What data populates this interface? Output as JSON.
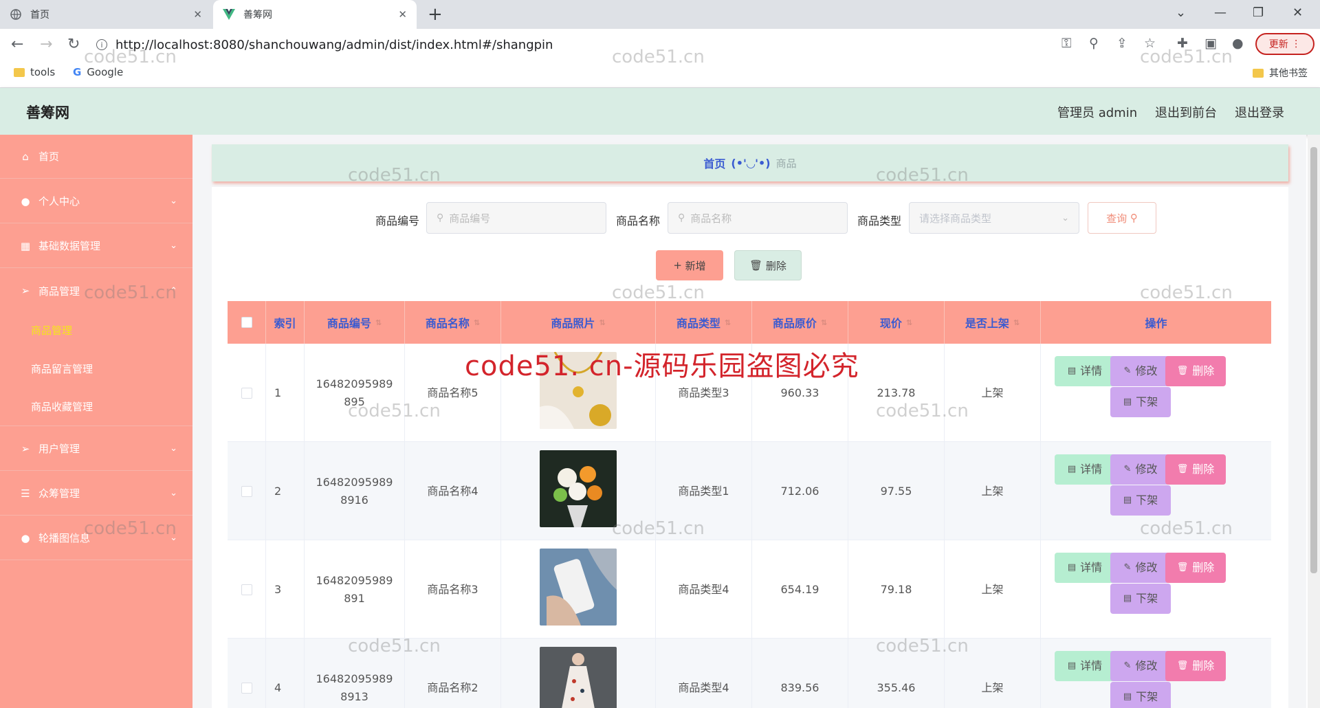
{
  "browser": {
    "tabs": [
      {
        "label": "首页",
        "active": false
      },
      {
        "label": "善筹网",
        "active": true
      }
    ],
    "url": "http://localhost:8080/shanchouwang/admin/dist/index.html#/shangpin",
    "update_label": "更新",
    "bookmarks": [
      "tools",
      "Google"
    ],
    "other_bookmarks": "其他书签"
  },
  "header": {
    "title": "善筹网",
    "admin_label": "管理员 admin",
    "to_front": "退出到前台",
    "logout": "退出登录"
  },
  "sidebar": {
    "items": [
      {
        "label": "首页",
        "icon": "home-icon"
      },
      {
        "label": "个人中心",
        "icon": "user-icon"
      },
      {
        "label": "基础数据管理",
        "icon": "grid-icon"
      },
      {
        "label": "商品管理",
        "icon": "send-icon"
      },
      {
        "label": "用户管理",
        "icon": "send-icon"
      },
      {
        "label": "众筹管理",
        "icon": "list-icon"
      },
      {
        "label": "轮播图信息",
        "icon": "user-icon"
      }
    ],
    "sub_items": [
      {
        "label": "商品管理",
        "active": true
      },
      {
        "label": "商品留言管理",
        "active": false
      },
      {
        "label": "商品收藏管理",
        "active": false
      }
    ]
  },
  "breadcrumb": {
    "home": "首页",
    "emote": "(•'◡'•)",
    "current": "商品"
  },
  "search": {
    "code_label": "商品编号",
    "code_placeholder": "商品编号",
    "name_label": "商品名称",
    "name_placeholder": "商品名称",
    "type_label": "商品类型",
    "type_placeholder": "请选择商品类型",
    "query_label": "查询"
  },
  "actions": {
    "add_label": "新增",
    "delete_label": "删除"
  },
  "table": {
    "columns": [
      "索引",
      "商品编号",
      "商品名称",
      "商品照片",
      "商品类型",
      "商品原价",
      "现价",
      "是否上架",
      "操作"
    ],
    "row_actions": {
      "detail": "详情",
      "edit": "修改",
      "delete": "删除",
      "off": "下架"
    },
    "rows": [
      {
        "index": "1",
        "code": "16482095989895",
        "name": "商品名称5",
        "photo": "necklace",
        "type": "商品类型3",
        "orig_price": "960.33",
        "price": "213.78",
        "status": "上架"
      },
      {
        "index": "2",
        "code": "164820959898916",
        "name": "商品名称4",
        "photo": "flowers",
        "type": "商品类型1",
        "orig_price": "712.06",
        "price": "97.55",
        "status": "上架"
      },
      {
        "index": "3",
        "code": "16482095989891",
        "name": "商品名称3",
        "photo": "phone",
        "type": "商品类型4",
        "orig_price": "654.19",
        "price": "79.18",
        "status": "上架"
      },
      {
        "index": "4",
        "code": "164820959898913",
        "name": "商品名称2",
        "photo": "dress",
        "type": "商品类型4",
        "orig_price": "839.56",
        "price": "355.46",
        "status": "上架"
      }
    ]
  },
  "watermark": {
    "small": "code51.cn",
    "big": "code51. cn-源码乐园盗图必究"
  },
  "colors": {
    "sidebar": "#fd9f91",
    "header": "#d9ede4",
    "accent_text": "#3a5bd1",
    "active_sub": "#f5e51b"
  }
}
